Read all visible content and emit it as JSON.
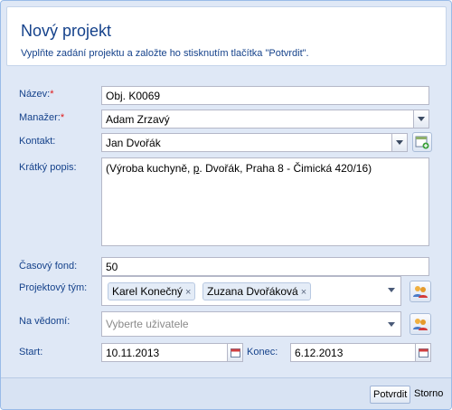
{
  "header": {
    "title": "Nový projekt",
    "subtitle": "Vyplňte zadání projektu a založte ho stisknutím tlačítka \"Potvrdit\"."
  },
  "form": {
    "name": {
      "label": "Název:",
      "required_mark": "*",
      "value": "Obj. K0069"
    },
    "manager": {
      "label": "Manažer:",
      "required_mark": "*",
      "value": "Adam Zrzavý"
    },
    "contact": {
      "label": "Kontakt:",
      "value": "Jan Dvořák",
      "add_icon": "add-contact-icon"
    },
    "description": {
      "label": "Krátký popis:",
      "value_before": "(Výroba kuchyně, ",
      "value_underlined": "p",
      "value_after": ". Dvořák, Praha 8 - Čimická 420/16)"
    },
    "time_budget": {
      "label": "Časový fond:",
      "value": "50"
    },
    "project_team": {
      "label": "Projektový tým:",
      "members": [
        "Karel Konečný",
        "Zuzana Dvořáková"
      ],
      "remove_glyph": "×",
      "users_icon": "users-icon"
    },
    "notified": {
      "label": "Na vědomí:",
      "placeholder": "Vyberte uživatele",
      "users_icon": "users-icon"
    },
    "start": {
      "label": "Start:",
      "value": "10.11.2013"
    },
    "end": {
      "label": "Konec:",
      "value": "6.12.2013"
    }
  },
  "footer": {
    "confirm_label": "Potvrdit",
    "cancel_label": "Storno"
  }
}
